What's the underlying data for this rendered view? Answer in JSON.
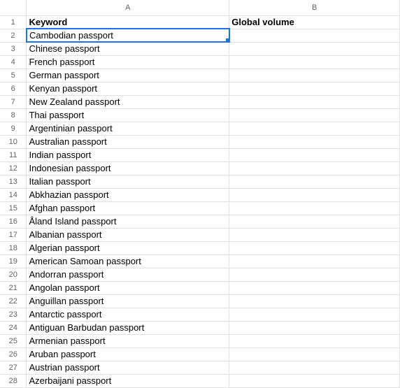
{
  "columns": [
    "A",
    "B"
  ],
  "header_row": {
    "number": 1,
    "col_a": "Keyword",
    "col_b": "Global volume"
  },
  "selected_row": 2,
  "rows": [
    {
      "number": 2,
      "col_a": "Cambodian passport",
      "col_b": ""
    },
    {
      "number": 3,
      "col_a": "Chinese passport",
      "col_b": ""
    },
    {
      "number": 4,
      "col_a": "French passport",
      "col_b": ""
    },
    {
      "number": 5,
      "col_a": "German passport",
      "col_b": ""
    },
    {
      "number": 6,
      "col_a": "Kenyan passport",
      "col_b": ""
    },
    {
      "number": 7,
      "col_a": "New Zealand passport",
      "col_b": ""
    },
    {
      "number": 8,
      "col_a": "Thai passport",
      "col_b": ""
    },
    {
      "number": 9,
      "col_a": "Argentinian passport",
      "col_b": ""
    },
    {
      "number": 10,
      "col_a": "Australian passport",
      "col_b": ""
    },
    {
      "number": 11,
      "col_a": "Indian passport",
      "col_b": ""
    },
    {
      "number": 12,
      "col_a": "Indonesian passport",
      "col_b": ""
    },
    {
      "number": 13,
      "col_a": "Italian passport",
      "col_b": ""
    },
    {
      "number": 14,
      "col_a": "Abkhazian passport",
      "col_b": ""
    },
    {
      "number": 15,
      "col_a": "Afghan passport",
      "col_b": ""
    },
    {
      "number": 16,
      "col_a": "Åland Island passport",
      "col_b": ""
    },
    {
      "number": 17,
      "col_a": "Albanian passport",
      "col_b": ""
    },
    {
      "number": 18,
      "col_a": "Algerian passport",
      "col_b": ""
    },
    {
      "number": 19,
      "col_a": "American Samoan passport",
      "col_b": ""
    },
    {
      "number": 20,
      "col_a": "Andorran passport",
      "col_b": ""
    },
    {
      "number": 21,
      "col_a": "Angolan passport",
      "col_b": ""
    },
    {
      "number": 22,
      "col_a": "Anguillan passport",
      "col_b": ""
    },
    {
      "number": 23,
      "col_a": "Antarctic passport",
      "col_b": ""
    },
    {
      "number": 24,
      "col_a": "Antiguan Barbudan passport",
      "col_b": ""
    },
    {
      "number": 25,
      "col_a": "Armenian passport",
      "col_b": ""
    },
    {
      "number": 26,
      "col_a": "Aruban passport",
      "col_b": ""
    },
    {
      "number": 27,
      "col_a": "Austrian passport",
      "col_b": ""
    },
    {
      "number": 28,
      "col_a": "Azerbaijani passport",
      "col_b": ""
    }
  ]
}
